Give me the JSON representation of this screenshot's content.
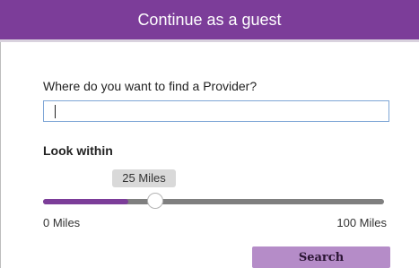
{
  "header": {
    "title": "Continue as a guest"
  },
  "form": {
    "question": "Where do you want to find a Provider?",
    "location_value": "",
    "look_within_label": "Look within"
  },
  "slider": {
    "value": 25,
    "min": 0,
    "max": 100,
    "value_label": "25 Miles",
    "min_label": "0 Miles",
    "max_label": "100 Miles"
  },
  "actions": {
    "search_label": "Search"
  },
  "colors": {
    "brand_purple": "#7c3d99",
    "button_purple": "#b58cc8",
    "track_gray": "#7f7f7f"
  }
}
